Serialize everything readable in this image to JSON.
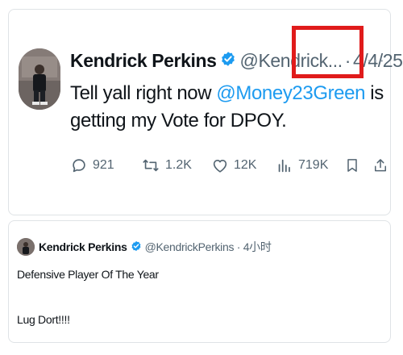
{
  "tweet": {
    "author_name": "Kendrick Perkins",
    "handle": "@Kendrick...",
    "separator": "·",
    "date": "4/4/25",
    "more": "···",
    "text_before": "Tell yall right now ",
    "mention": "@Money23Green",
    "text_after": " is getting my Vote for DPOY.",
    "replies": "921",
    "reposts": "1.2K",
    "likes": "12K",
    "views": "719K",
    "icons": [
      "reply-icon",
      "repost-icon",
      "like-icon",
      "views-icon",
      "bookmark-icon",
      "share-icon"
    ]
  },
  "quoted": {
    "author_name": "Kendrick Perkins",
    "handle_time": "@KendrickPerkins · 4小时",
    "line1": "Defensive Player Of The Year",
    "line2": "Lug Dort!!!!"
  },
  "colors": {
    "accent": "#1d9bf0",
    "highlight": "#e01b1b",
    "muted": "#536471",
    "text": "#0f1419"
  }
}
